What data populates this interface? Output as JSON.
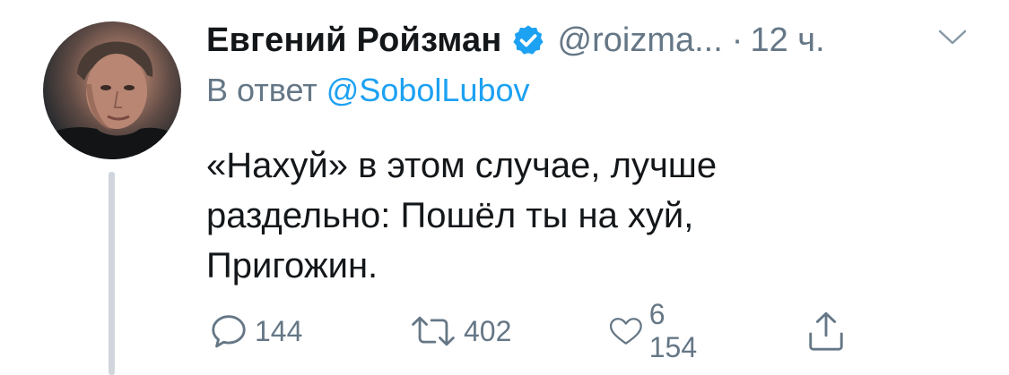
{
  "tweet": {
    "author_name": "Евгений Ройзман",
    "handle": "@roizma...",
    "separator": "·",
    "time": "12 ч.",
    "reply_prefix": "В ответ",
    "reply_mention": "@SobolLubov",
    "text_lines": [
      "«Нахуй» в этом случае, лучше",
      "раздельно: Пошёл ты на хуй,",
      "Пригожин."
    ]
  },
  "actions": {
    "reply_count": "144",
    "retweet_count": "402",
    "like_count": "6 154"
  },
  "icons": {
    "verified": "verified-badge-icon",
    "menu": "chevron-down-icon",
    "reply": "reply-bubble-icon",
    "retweet": "retweet-icon",
    "like": "heart-icon",
    "share": "share-icon"
  },
  "colors": {
    "text": "#14171a",
    "secondary": "#657786",
    "accent": "#1da1f2",
    "thread_line": "#d0d6db"
  }
}
